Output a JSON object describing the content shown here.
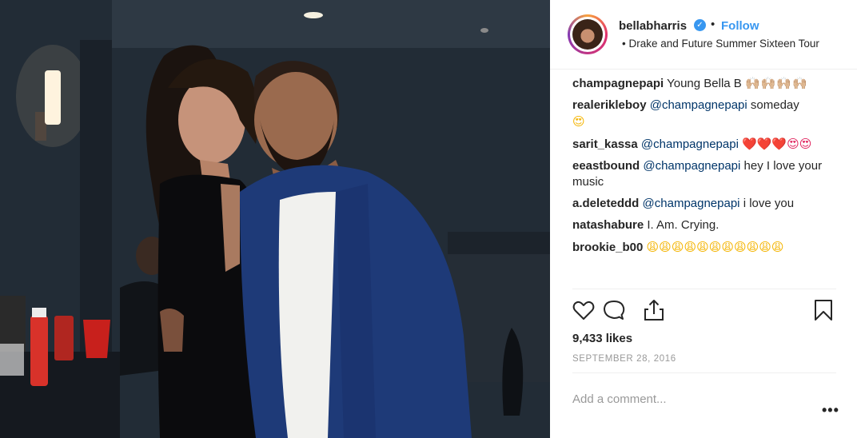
{
  "post": {
    "author": {
      "username": "bellabharris",
      "verified_glyph": "✓",
      "separator": "•",
      "follow_label": "Follow",
      "location_prefix": "•",
      "location": "Drake and Future Summer Sixteen Tour"
    },
    "comments": [
      {
        "user": "champagnepapi",
        "mention": "",
        "text": "Young Bella B",
        "emoji": "🙌🏼🙌🏼🙌🏼🙌🏼",
        "emoji_kind": "pray"
      },
      {
        "user": "realerikleboy",
        "mention": "@champagnepapi",
        "text": "someday",
        "emoji": "😍",
        "emoji_kind": "face"
      },
      {
        "user": "sarit_kassa",
        "mention": "@champagnepapi",
        "text": "",
        "emoji": "❤️❤️❤️😍😍",
        "emoji_kind": "heart"
      },
      {
        "user": "eeastbound",
        "mention": "@champagnepapi",
        "text": "hey I love your music",
        "emoji": "",
        "emoji_kind": ""
      },
      {
        "user": "a.deleteddd",
        "mention": "@champagnepapi",
        "text": "i love you",
        "emoji": "",
        "emoji_kind": ""
      },
      {
        "user": "natashabure",
        "mention": "",
        "text": "I. Am. Crying.",
        "emoji": "",
        "emoji_kind": ""
      },
      {
        "user": "brookie_b00",
        "mention": "",
        "text": "",
        "emoji": "😩😩😩😩😩😩😩😩😩😩😩",
        "emoji_kind": "face"
      }
    ],
    "actions": {
      "like_icon": "heart-outline-icon",
      "comment_icon": "speech-bubble-icon",
      "share_icon": "share-upload-icon",
      "save_icon": "bookmark-icon"
    },
    "likes": "9,433 likes",
    "date": "SEPTEMBER 28, 2016",
    "add_comment_placeholder": "Add a comment...",
    "more_label": "•••"
  },
  "colors": {
    "link": "#3897f0",
    "mention": "#003569",
    "muted": "#999999",
    "text": "#262626",
    "divider": "#efefef"
  }
}
